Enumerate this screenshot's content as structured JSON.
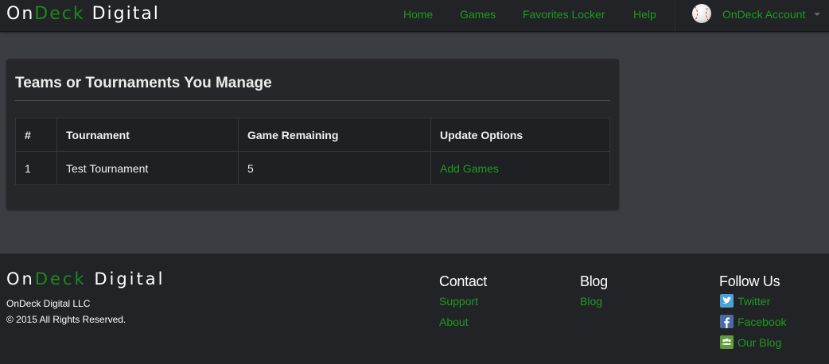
{
  "brand": {
    "part1": "On",
    "part2": "Deck",
    "part3": " Digital"
  },
  "nav": {
    "items": [
      {
        "label": "Home"
      },
      {
        "label": "Games"
      },
      {
        "label": "Favorites Locker"
      },
      {
        "label": "Help"
      }
    ],
    "account": {
      "label": "OnDeck Account",
      "avatar_icon": "baseball-icon"
    }
  },
  "panel": {
    "title": "Teams or Tournaments You Manage",
    "table": {
      "headers": [
        "#",
        "Tournament",
        "Game Remaining",
        "Update Options"
      ],
      "rows": [
        [
          "1",
          "Test Tournament",
          "5",
          "Add Games"
        ]
      ]
    }
  },
  "footer": {
    "company": "OnDeck Digital LLC",
    "copyright": "© 2015 All Rights Reserved.",
    "contact": {
      "heading": "Contact",
      "links": [
        "Support",
        "About"
      ]
    },
    "blog": {
      "heading": "Blog",
      "links": [
        "Blog"
      ]
    },
    "follow": {
      "heading": "Follow Us",
      "links": [
        {
          "label": "Twitter",
          "icon": "twitter-icon"
        },
        {
          "label": "Facebook",
          "icon": "facebook-icon"
        },
        {
          "label": "Our Blog",
          "icon": "blog-icon"
        }
      ]
    }
  },
  "colors": {
    "accent_green": "#1e9b1e",
    "navbar_bg": "#222327",
    "page_bg": "#3a3d42",
    "panel_bg": "#26272b",
    "twitter_blue": "#49a1d6",
    "facebook_blue": "#4a6aa8",
    "blog_green": "#5f9b3a"
  }
}
